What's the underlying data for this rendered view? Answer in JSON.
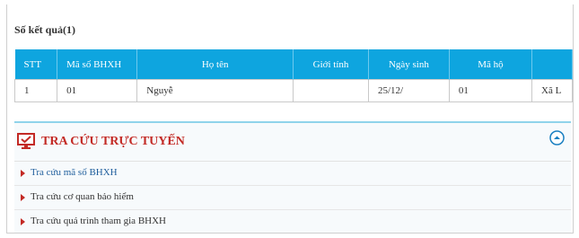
{
  "results": {
    "count_label": "Số kết quả(1)",
    "columns": [
      "STT",
      "Mã số BHXH",
      "Họ tên",
      "Giới tính",
      "Ngày sinh",
      "Mã hộ",
      ""
    ],
    "rows": [
      [
        "1",
        "01",
        "Nguyễ",
        "",
        "25/12/",
        "01",
        "Xã L"
      ]
    ]
  },
  "panel": {
    "title": "TRA CỨU TRỰC TUYẾN",
    "links": [
      "Tra cứu mã số BHXH",
      "Tra cứu cơ quan bảo hiểm",
      "Tra cứu quá trình tham gia BHXH"
    ]
  },
  "colors": {
    "header_bg": "#0ea5df",
    "title_red": "#c32a25",
    "link_blue": "#1f5e9c",
    "link_dark": "#333333"
  },
  "icons": {
    "panel": "monitor-check-icon",
    "collapse": "chevron-up-circle-icon",
    "bullet": "triangle-right-icon"
  }
}
